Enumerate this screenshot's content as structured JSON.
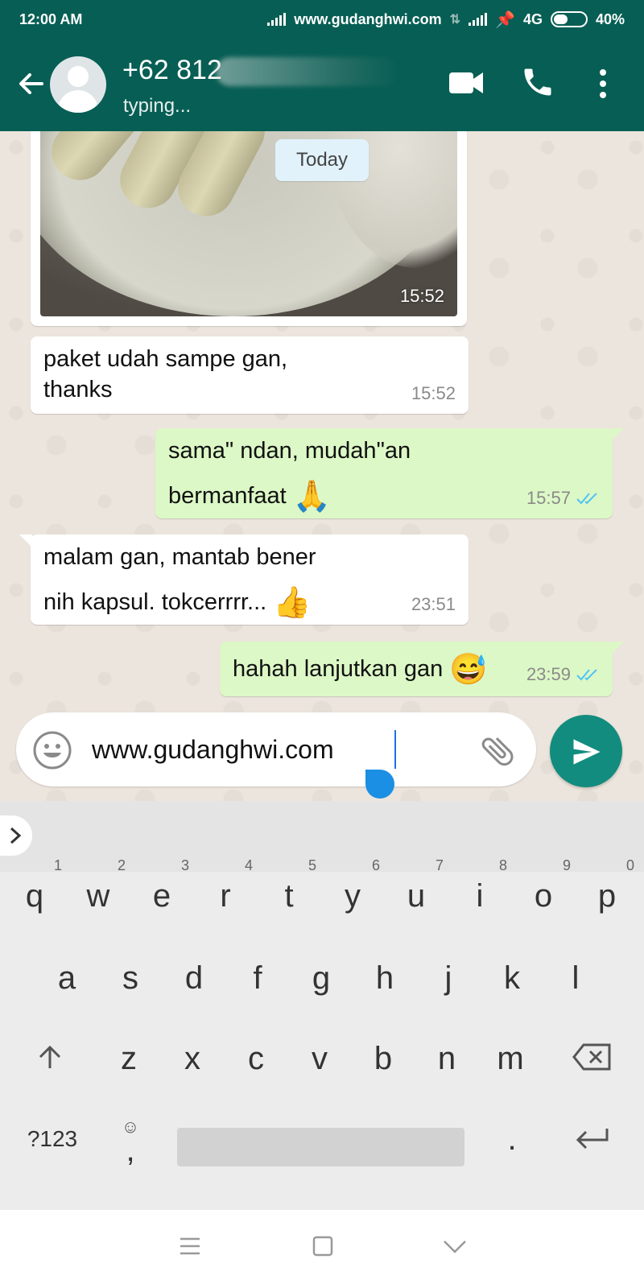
{
  "statusbar": {
    "time": "12:00 AM",
    "carrier_text": "www.gudanghwi.com",
    "network": "4G",
    "battery": "40%",
    "icons": [
      "signal-icon",
      "data-activity-icon",
      "signal-icon",
      "pin-icon",
      "battery-icon"
    ]
  },
  "header": {
    "contact_name": "+62 812",
    "contact_status": "typing...",
    "icons": [
      "back-arrow-icon",
      "avatar-icon",
      "video-call-icon",
      "phone-call-icon",
      "more-vertical-icon"
    ]
  },
  "chat": {
    "date_chip": "Today",
    "photo_message": {
      "time": "15:52"
    },
    "messages": [
      {
        "direction": "in",
        "lines": [
          "paket udah sampe gan,",
          "thanks"
        ],
        "time": "15:52"
      },
      {
        "direction": "out",
        "lines": [
          "sama\" ndan, mudah\"an",
          "bermanfaat"
        ],
        "emoji": "🙏",
        "time": "15:57",
        "status": "read"
      },
      {
        "direction": "in",
        "lines": [
          "malam gan, mantab bener",
          "nih kapsul. tokcerrrr..."
        ],
        "emoji": "👍",
        "time": "23:51"
      },
      {
        "direction": "out",
        "lines": [
          "hahah lanjutkan gan"
        ],
        "emoji": "😅",
        "time": "23:59",
        "status": "read"
      }
    ]
  },
  "composer": {
    "value": "www.gudanghwi.com",
    "icons": [
      "emoji-icon",
      "attach-icon",
      "send-icon"
    ]
  },
  "keyboard": {
    "row1": [
      {
        "k": "q",
        "h": "1"
      },
      {
        "k": "w",
        "h": "2"
      },
      {
        "k": "e",
        "h": "3"
      },
      {
        "k": "r",
        "h": "4"
      },
      {
        "k": "t",
        "h": "5"
      },
      {
        "k": "y",
        "h": "6"
      },
      {
        "k": "u",
        "h": "7"
      },
      {
        "k": "i",
        "h": "8"
      },
      {
        "k": "o",
        "h": "9"
      },
      {
        "k": "p",
        "h": "0"
      }
    ],
    "row2": [
      "a",
      "s",
      "d",
      "f",
      "g",
      "h",
      "j",
      "k",
      "l"
    ],
    "row3": [
      "z",
      "x",
      "c",
      "v",
      "b",
      "n",
      "m"
    ],
    "symbols_label": "?123",
    "comma_label": ",",
    "period_label": ".",
    "icons": [
      "shift-icon",
      "backspace-icon",
      "emoji-key-icon",
      "enter-icon",
      "expand-suggestions-icon"
    ]
  },
  "navbar": {
    "icons": [
      "menu-icon",
      "home-icon",
      "back-icon"
    ]
  },
  "colors": {
    "header": "#075e54",
    "outgoing_bubble": "#dcf8c6",
    "incoming_bubble": "#ffffff",
    "send_button": "#128c7e",
    "read_ticks": "#4fc3f7",
    "caret": "#1a8fe3"
  }
}
